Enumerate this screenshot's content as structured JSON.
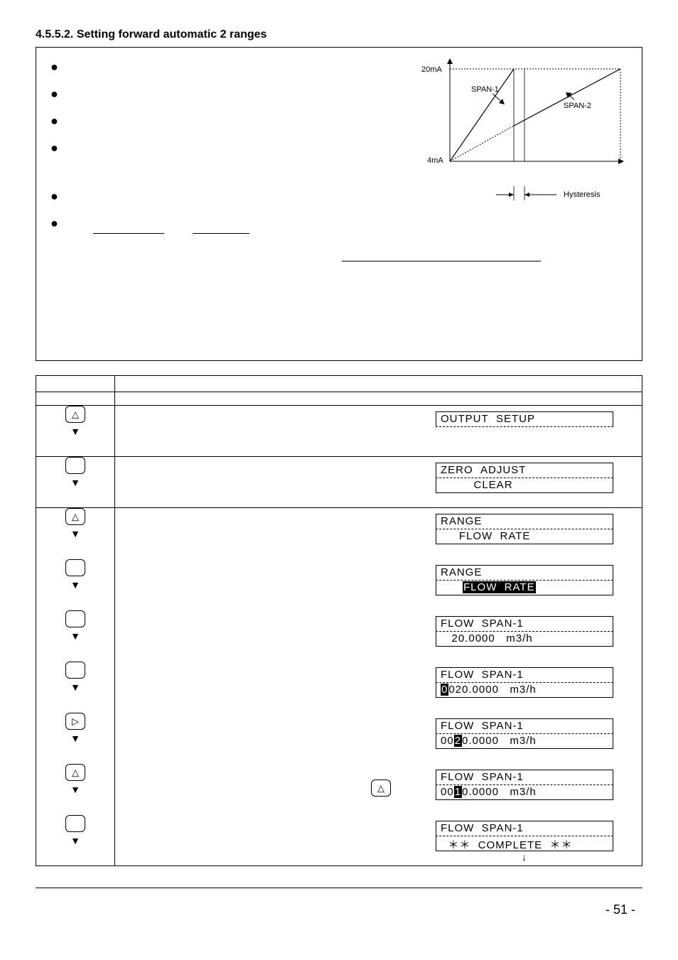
{
  "section_title": "4.5.5.2. Setting forward automatic 2 ranges",
  "chart": {
    "y_top_label": "20mA",
    "y_bot_label": "4mA",
    "span1_label": "SPAN-1",
    "span2_label": "SPAN-2",
    "hyst_label": "Hysteresis"
  },
  "steps": [
    {
      "key": "up",
      "lcd1": "OUTPUT  SETUP",
      "lcd2": "",
      "lcd2_plain": true
    },
    {
      "key": "blank",
      "lcd1": "ZERO  ADJUST",
      "lcd2": "         CLEAR"
    },
    {
      "key": "up",
      "lcd1": "RANGE",
      "lcd2": "     FLOW  RATE"
    },
    {
      "key": "blank",
      "lcd1": "RANGE",
      "lcd2_html": "      <span class=\"inv\">FLOW&nbsp;&nbsp;RATE</span>"
    },
    {
      "key": "blank",
      "lcd1": "FLOW  SPAN-1",
      "lcd2": "   20.0000   m3/h"
    },
    {
      "key": "blank",
      "lcd1": "FLOW  SPAN-1",
      "lcd2_html": "<span class=\"inv\">0</span>020.0000   m3/h"
    },
    {
      "key": "right",
      "lcd1": "FLOW  SPAN-1",
      "lcd2_html": "00<span class=\"inv\">2</span>0.0000   m3/h"
    },
    {
      "key": "up",
      "inline_key": "up",
      "lcd1": "FLOW  SPAN-1",
      "lcd2_html": "00<span class=\"inv\">1</span>0.0000   m3/h"
    },
    {
      "key": "blank",
      "lcd1": "FLOW  SPAN-1",
      "lcd2": "  ＊＊  COMPLETE  ＊＊",
      "after_arrow": true
    }
  ],
  "page_number": "- 51 -",
  "chart_data": {
    "type": "line",
    "title": "",
    "xlabel": "",
    "ylabel": "",
    "y_ticks": [
      "4mA",
      "20mA"
    ],
    "series": [
      {
        "name": "SPAN-1",
        "points": [
          [
            0,
            4
          ],
          [
            40,
            20
          ]
        ]
      },
      {
        "name": "SPAN-2",
        "points": [
          [
            0,
            4
          ],
          [
            100,
            20
          ]
        ]
      }
    ],
    "annotations": [
      "Hysteresis"
    ]
  }
}
